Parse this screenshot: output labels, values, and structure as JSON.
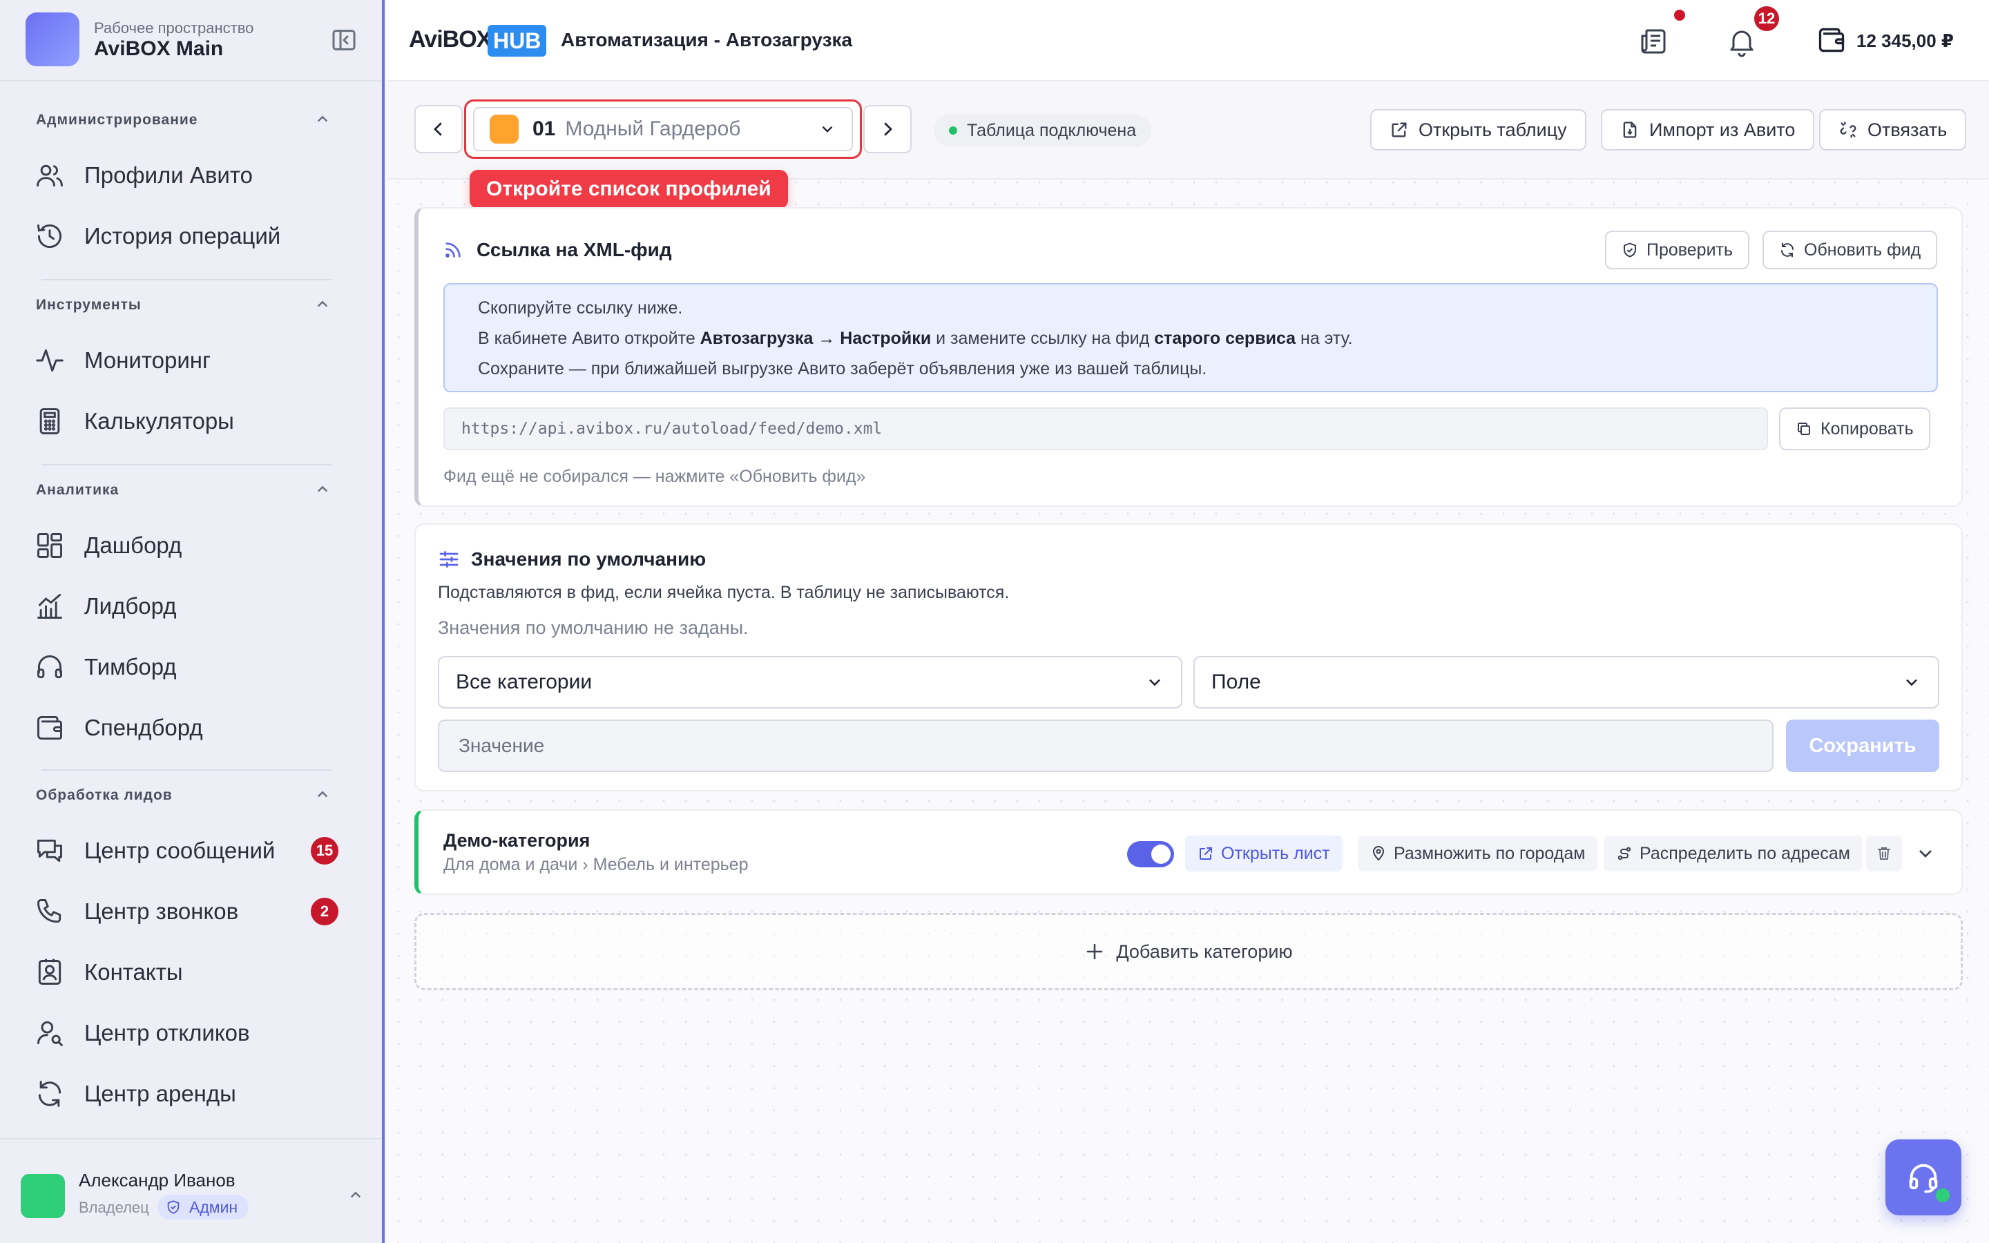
{
  "workspace": {
    "subtitle": "Рабочее пространство",
    "name": "AviBOX Main"
  },
  "sidebar": {
    "sections": [
      {
        "title": "Администрирование",
        "items": [
          {
            "label": "Профили Авито",
            "icon": "users-icon"
          },
          {
            "label": "История операций",
            "icon": "history-icon"
          }
        ]
      },
      {
        "title": "Инструменты",
        "items": [
          {
            "label": "Мониторинг",
            "icon": "activity-icon"
          },
          {
            "label": "Калькуляторы",
            "icon": "calculator-icon"
          }
        ]
      },
      {
        "title": "Аналитика",
        "items": [
          {
            "label": "Дашборд",
            "icon": "dashboard-icon"
          },
          {
            "label": "Лидборд",
            "icon": "bar-chart-icon"
          },
          {
            "label": "Тимборд",
            "icon": "headphones-icon"
          },
          {
            "label": "Спендборд",
            "icon": "wallet-icon"
          }
        ]
      },
      {
        "title": "Обработка лидов",
        "items": [
          {
            "label": "Центр сообщений",
            "icon": "messages-icon",
            "badge": "15"
          },
          {
            "label": "Центр звонков",
            "icon": "phone-icon",
            "badge": "2"
          },
          {
            "label": "Контакты",
            "icon": "contacts-icon"
          },
          {
            "label": "Центр откликов",
            "icon": "user-search-icon"
          },
          {
            "label": "Центр аренды",
            "icon": "refresh-icon"
          }
        ]
      }
    ],
    "user": {
      "name": "Александр Иванов",
      "role": "Владелец",
      "badge": "Админ"
    }
  },
  "header": {
    "brand": "AviBOX",
    "brand_badge": "HUB",
    "title": "Автоматизация - Автозагрузка",
    "notifications_count": "12",
    "balance": "12 345,00 ₽"
  },
  "toolbar": {
    "profile_number": "01",
    "profile_name": "Модный Гардероб",
    "tooltip": "Откройте список профилей",
    "connection_status": "Таблица подключена",
    "open_table": "Открыть таблицу",
    "import_avito": "Импорт из Авито",
    "unlink": "Отвязать"
  },
  "feed": {
    "title": "Ссылка на XML-фид",
    "check": "Проверить",
    "refresh": "Обновить фид",
    "info_line1": "Скопируйте ссылку ниже.",
    "info_line2_a": "В кабинете Авито откройте ",
    "info_line2_b": "Автозагрузка → Настройки",
    "info_line2_c": " и замените ссылку на фид ",
    "info_line2_d": "старого сервиса",
    "info_line2_e": " на эту.",
    "info_line3": "Сохраните — при ближайшей выгрузке Авито заберёт объявления уже из вашей таблицы.",
    "url": "https://api.avibox.ru/autoload/feed/demo.xml",
    "copy": "Копировать",
    "note": "Фид ещё не собирался — нажмите «Обновить фид»"
  },
  "defaults": {
    "title": "Значения по умолчанию",
    "description": "Подставляются в фид, если ячейка пуста. В таблицу не записываются.",
    "empty": "Значения по умолчанию не заданы.",
    "category_select": "Все категории",
    "field_select": "Поле",
    "value_placeholder": "Значение",
    "save": "Сохранить"
  },
  "category": {
    "name": "Демо-категория",
    "path": "Для дома и дачи › Мебель и интерьер",
    "open_sheet": "Открыть лист",
    "multiply_cities": "Размножить по городам",
    "distribute_addresses": "Распределить по адресам",
    "add_category": "Добавить категорию"
  },
  "colors": {
    "accent": "#5a63e8",
    "brand_badge": "#2d8cf0",
    "danger": "#e5343d",
    "success": "#22c06a",
    "profile": "#ffa22e"
  }
}
